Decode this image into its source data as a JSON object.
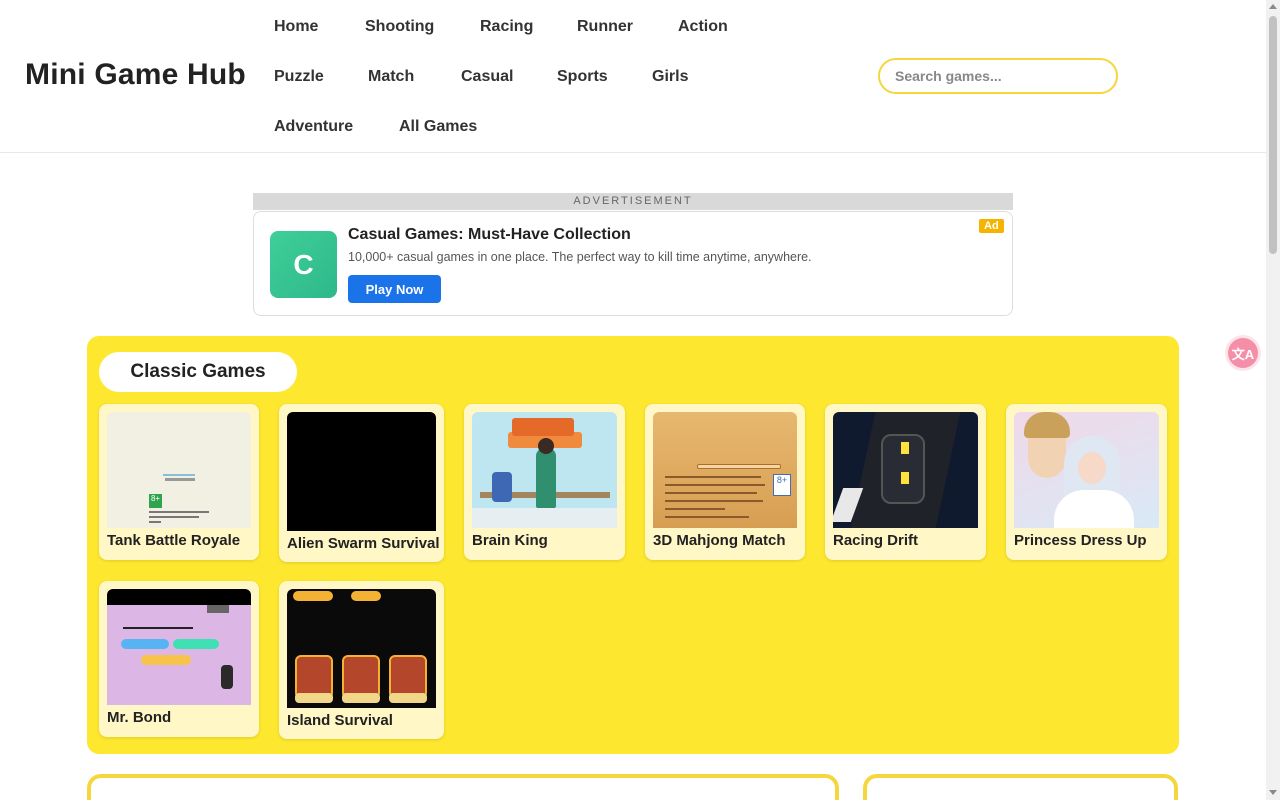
{
  "site": {
    "logo": "Mini Game Hub"
  },
  "nav": [
    {
      "label": "Home"
    },
    {
      "label": "Shooting"
    },
    {
      "label": "Racing"
    },
    {
      "label": "Runner"
    },
    {
      "label": "Action"
    },
    {
      "label": "Puzzle"
    },
    {
      "label": "Match"
    },
    {
      "label": "Casual"
    },
    {
      "label": "Sports"
    },
    {
      "label": "Girls"
    },
    {
      "label": "Adventure"
    },
    {
      "label": "All Games"
    }
  ],
  "search": {
    "placeholder": "Search games..."
  },
  "translate": {
    "icon": "translate-icon",
    "glyph": "文A"
  },
  "ad": {
    "label": "ADVERTISEMENT",
    "logo_letter": "C",
    "title": "Casual Games: Must-Have Collection",
    "description": "10,000+ casual games in one place. The perfect way to kill time anytime, anywhere.",
    "button": "Play Now",
    "badge": "Ad"
  },
  "classic": {
    "title": "Classic Games",
    "games": [
      {
        "name": "Tank Battle Royale"
      },
      {
        "name": "Alien Swarm Survival"
      },
      {
        "name": "Brain King"
      },
      {
        "name": "3D Mahjong Match"
      },
      {
        "name": "Racing Drift"
      },
      {
        "name": "Princess Dress Up"
      },
      {
        "name": "Mr. Bond"
      },
      {
        "name": "Island Survival"
      }
    ]
  },
  "colors": {
    "accent": "#fde72f",
    "search_border": "#f5d63d",
    "ad_button": "#1a73e8",
    "ad_badge": "#f4b400"
  }
}
